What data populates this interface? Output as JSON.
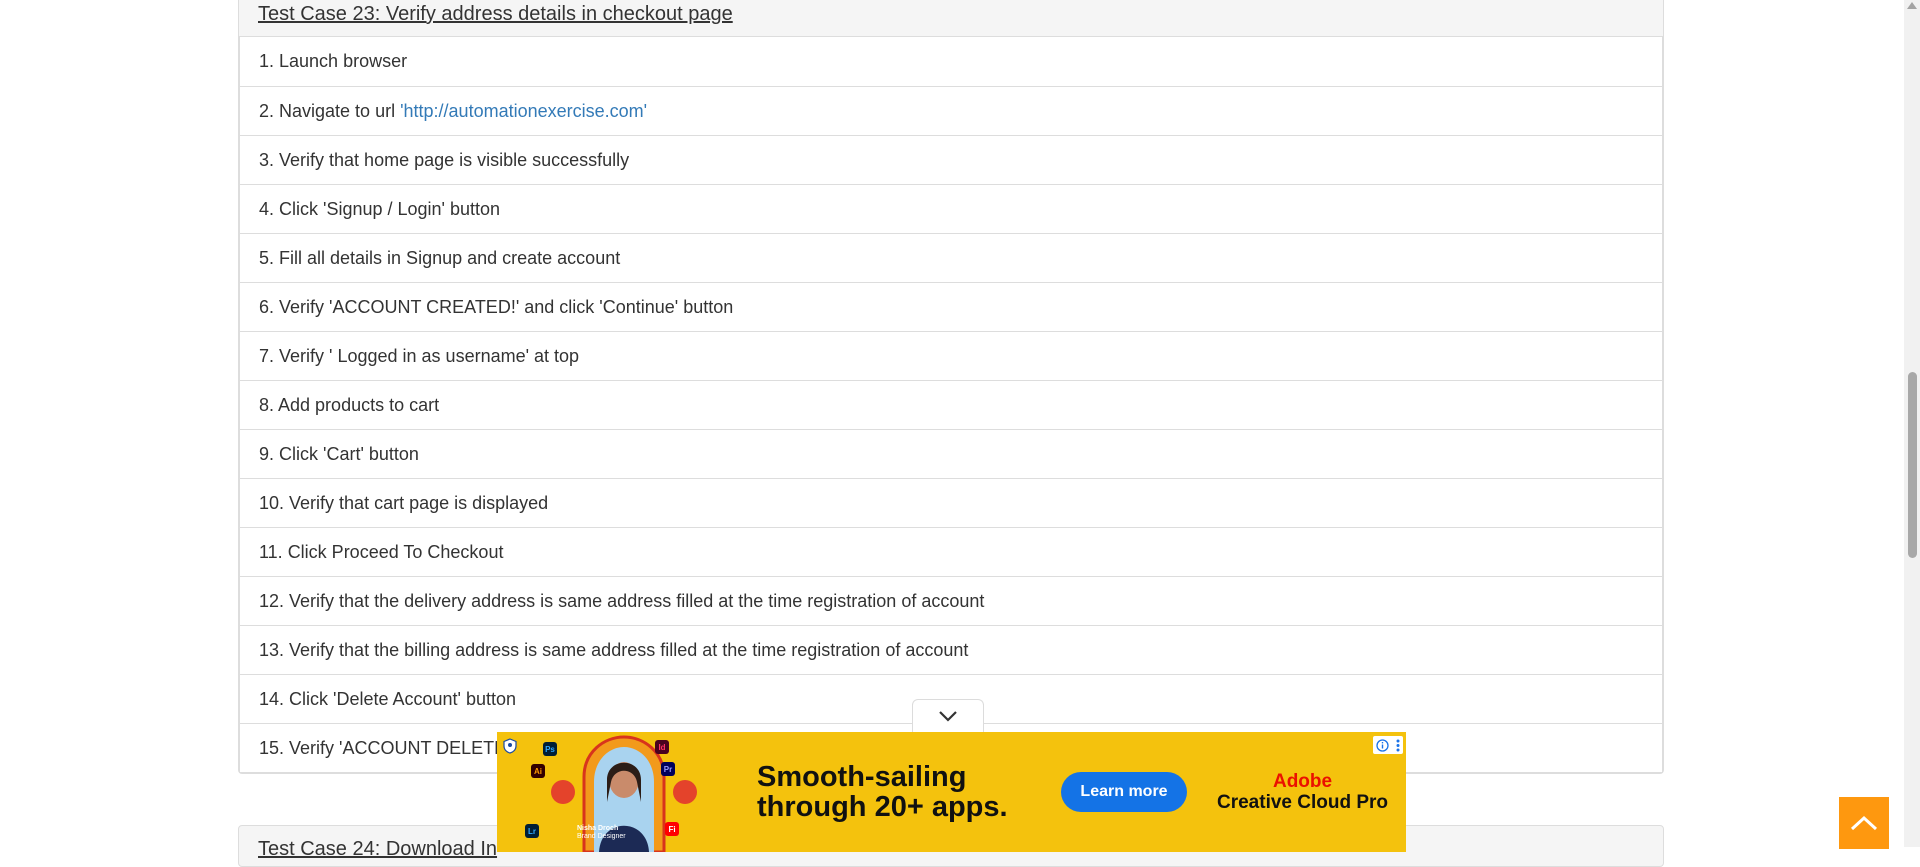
{
  "test_case_23": {
    "title": "Test Case 23: Verify address details in checkout page",
    "steps": [
      "1. Launch browser",
      "2. Navigate to url",
      "3. Verify that home page is visible successfully",
      "4. Click 'Signup / Login' button",
      "5. Fill all details in Signup and create account",
      "6. Verify 'ACCOUNT CREATED!' and click 'Continue' button",
      "7. Verify ' Logged in as username' at top",
      "8. Add products to cart",
      "9. Click 'Cart' button",
      "10. Verify that cart page is displayed",
      "11. Click Proceed To Checkout",
      "12. Verify that the delivery address is same address filled at the time registration of account",
      "13. Verify that the billing address is same address filled at the time registration of account",
      "14. Click 'Delete Account' button",
      "15. Verify 'ACCOUNT DELETED"
    ],
    "url_link": "'http://automationexercise.com'"
  },
  "test_case_24": {
    "title": "Test Case 24: Download In"
  },
  "ad": {
    "headline_line1": "Smooth-sailing",
    "headline_line2": "through 20+ apps.",
    "cta": "Learn more",
    "brand_line1": "Adobe",
    "brand_line2": "Creative Cloud Pro",
    "person_name": "Nisha Droch",
    "person_role": "Brand Designer",
    "app_tiles": [
      {
        "label": "Ps",
        "bg": "#001e36",
        "fg": "#31a8ff"
      },
      {
        "label": "Id",
        "bg": "#49021f",
        "fg": "#ff3366"
      },
      {
        "label": "Ai",
        "bg": "#330000",
        "fg": "#ff9a00"
      },
      {
        "label": "Pr",
        "bg": "#00005b",
        "fg": "#9999ff"
      },
      {
        "label": "Lr",
        "bg": "#001e36",
        "fg": "#31a8ff"
      },
      {
        "label": "Fi",
        "bg": "#ff0000",
        "fg": "#ffffff"
      }
    ]
  },
  "colors": {
    "link": "#337ab7",
    "scroll_top": "#fe980f",
    "ad_bg": "#f4c20d",
    "ad_cta": "#1473e6"
  },
  "icons": [
    "chevron-down-icon",
    "chevron-up-icon",
    "info-icon",
    "more-vert-icon",
    "shield-icon"
  ]
}
